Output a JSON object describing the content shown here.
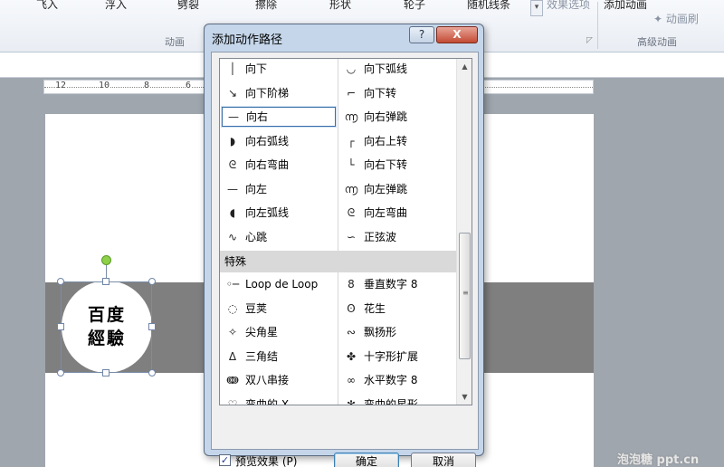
{
  "ribbon": {
    "items": [
      "飞入",
      "浮入",
      "劈裂",
      "擦除",
      "形状",
      "轮子",
      "随机线条"
    ],
    "effect_options": "效果选项",
    "add_animation": "添加动画",
    "animation_painter": "动画刷",
    "group_animation": "动画",
    "group_advanced": "高级动画"
  },
  "ruler": {
    "numbers": [
      "12",
      "10",
      "8",
      "6"
    ]
  },
  "slide": {
    "logo_line1": "百度",
    "logo_line2": "經驗"
  },
  "dialog": {
    "title": "添加动作路径",
    "help_label": "?",
    "close_label": "X",
    "paths": [
      {
        "left": "向下",
        "left_icon": "line-down",
        "right": "向下弧线",
        "right_icon": "arc-down"
      },
      {
        "left": "向下阶梯",
        "left_icon": "stairs-down",
        "right": "向下转",
        "right_icon": "turn-down"
      },
      {
        "left": "向右",
        "left_icon": "line-right",
        "right": "向右弹跳",
        "right_icon": "bounce-right"
      },
      {
        "left": "向右弧线",
        "left_icon": "arc-right",
        "right": "向右上转",
        "right_icon": "turn-up-right"
      },
      {
        "left": "向右弯曲",
        "left_icon": "curvy-right",
        "right": "向右下转",
        "right_icon": "turn-down-right"
      },
      {
        "left": "向左",
        "left_icon": "line-left",
        "right": "向左弹跳",
        "right_icon": "bounce-left"
      },
      {
        "left": "向左弧线",
        "left_icon": "arc-left",
        "right": "向左弯曲",
        "right_icon": "curvy-left"
      },
      {
        "left": "心跳",
        "left_icon": "heartbeat",
        "right": "正弦波",
        "right_icon": "sine-wave"
      }
    ],
    "special_section": "特殊",
    "special": [
      {
        "left": "Loop de Loop",
        "left_icon": "loop-de-loop",
        "right": "垂直数字 8",
        "right_icon": "figure-8-vertical"
      },
      {
        "left": "豆荚",
        "left_icon": "bean",
        "right": "花生",
        "right_icon": "peanut"
      },
      {
        "left": "尖角星",
        "left_icon": "pointy-star",
        "right": "飘扬形",
        "right_icon": "swoosh"
      },
      {
        "left": "三角结",
        "left_icon": "triangle-knot",
        "right": "十字形扩展",
        "right_icon": "cross-expand"
      },
      {
        "left": "双八串接",
        "left_icon": "double-eight",
        "right": "水平数字 8",
        "right_icon": "figure-8-horizontal"
      },
      {
        "left": "弯曲的 X",
        "left_icon": "curvy-x",
        "right": "弯曲的星形",
        "right_icon": "curvy-star"
      }
    ],
    "selected": "向右",
    "preview_label": "预览效果 (P)",
    "preview_checked": "✓",
    "ok_label": "确定",
    "cancel_label": "取消"
  },
  "watermark": "泡泡糖 ppt.cn"
}
